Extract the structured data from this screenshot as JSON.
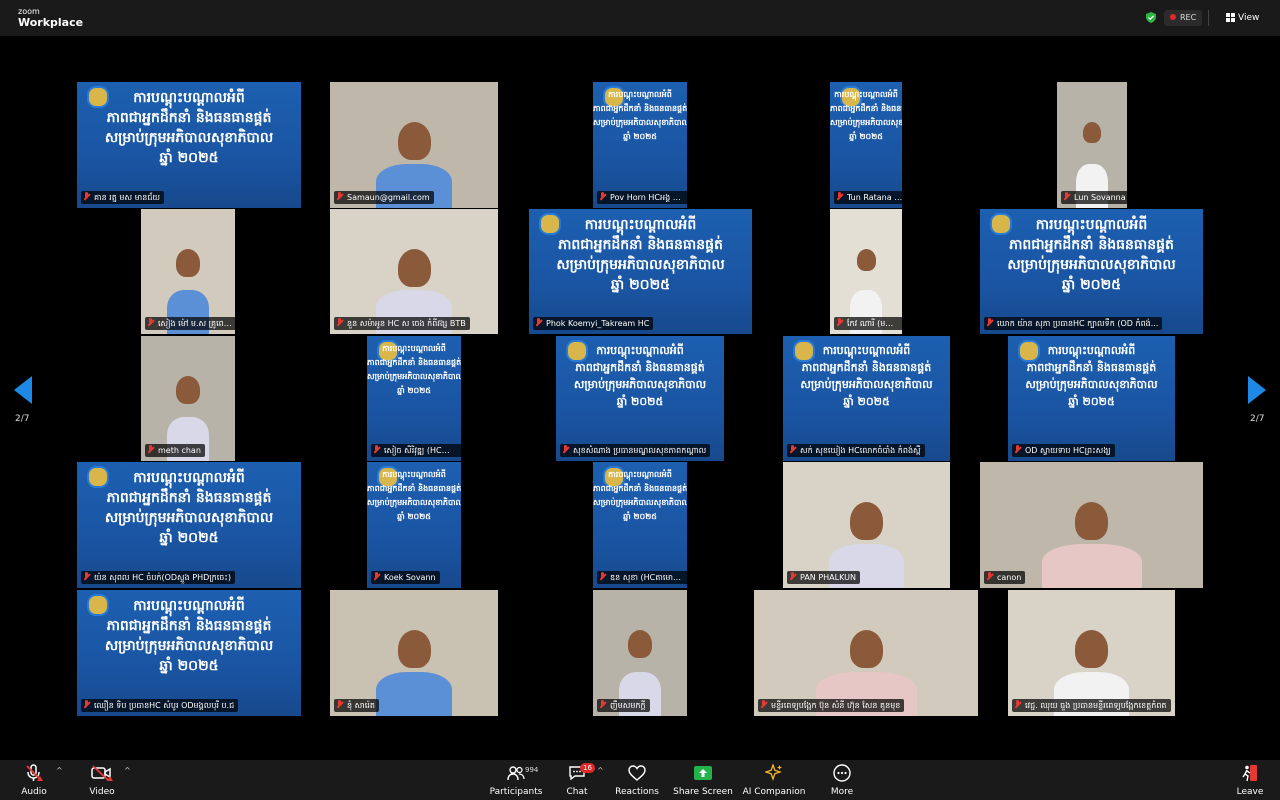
{
  "app": {
    "brand_top": "zoom",
    "brand_bottom": "Workplace"
  },
  "topbar": {
    "rec_label": "REC",
    "view_label": "View"
  },
  "slide_text": [
    "ការបណ្ដុះបណ្ដាលអំពី",
    "ភាពជាអ្នកដឹកនាំ និងធនធានផ្គត់",
    "សម្រាប់ក្រុមអភិបាលសុខាភិបាល",
    "ឆ្នាំ ២០២៥"
  ],
  "pagination": {
    "left": "2/7",
    "right": "2/7"
  },
  "participants": [
    {
      "name": "គាន រត្ន មស មានជ័យ"
    },
    {
      "name": "Samaun@gmail.com"
    },
    {
      "name": "Pov Horn HCអង្គ ODប៉ោយប៉ែត"
    },
    {
      "name": "Tun Ratana RH Stoung"
    },
    {
      "name": "Lun Sovanna"
    },
    {
      "name": "សៀង ម៉ៅ ម.ស គ្រូពេទ្យសហការ"
    },
    {
      "name": "នួន សម៉ាអូន HC ស ចេង កំពីវង្ស BTB"
    },
    {
      "name": "Phok Koemyi_Takream HC"
    },
    {
      "name": "កែវ ណារី (មណ្ឌលសុខភាពព្រៃ)"
    },
    {
      "name": "ឃោក យ៉ាន សុភា ប្រធានHC ក្បាលទឹក (OD កំពង់..."
    },
    {
      "name": "meth chan"
    },
    {
      "name": "សៀច សិរិវុឌ្ឍ (HCព្រែកកំពីស ODខ្មែរ)"
    },
    {
      "name": "សុខសំណាង ប្រធានមណ្ឌលសុខភាពកណ្ដាល"
    },
    {
      "name": "សក់ សុខឃៀង HCលោកចំបាំង កំពង់ស្ពឺ"
    },
    {
      "name": "OD ស្វាយទាប HCព្រះសង្ឃ"
    },
    {
      "name": "យ៉ន សុពល HC ចំបក់(ODស្ទួង PHDក្រចេះ)"
    },
    {
      "name": "Koek Sovann"
    },
    {
      "name": "ឌន សុខា (HCតាមោទក្សុម OD ស្វាយចេក កណ្ដាល"
    },
    {
      "name": "PAN PHALKUN"
    },
    {
      "name": "canon"
    },
    {
      "name": "ឈឿន ទិប ប្រធានHC សំបូរ ODមង្គលបុរី ប.ជ"
    },
    {
      "name": "នុំ សារ៉េត"
    },
    {
      "name": "ញឹមសមកក្តី"
    },
    {
      "name": "មន្ទីរពេទ្យបង្អែក ប៊ុន សំនី ហ៊ុន សែន គូនមុខ"
    },
    {
      "name": "វេជ្ជ. ឈុយ ធួង ប្រធានមន្ទីរពេទ្យបង្អែកខេត្តកំពត"
    }
  ],
  "toolbar": {
    "audio": "Audio",
    "video": "Video",
    "participants": "Participants",
    "participants_count": "994",
    "chat": "Chat",
    "chat_badge": "16",
    "reactions": "Reactions",
    "share_screen": "Share Screen",
    "ai_companion": "AI Companion",
    "more": "More",
    "leave": "Leave"
  }
}
